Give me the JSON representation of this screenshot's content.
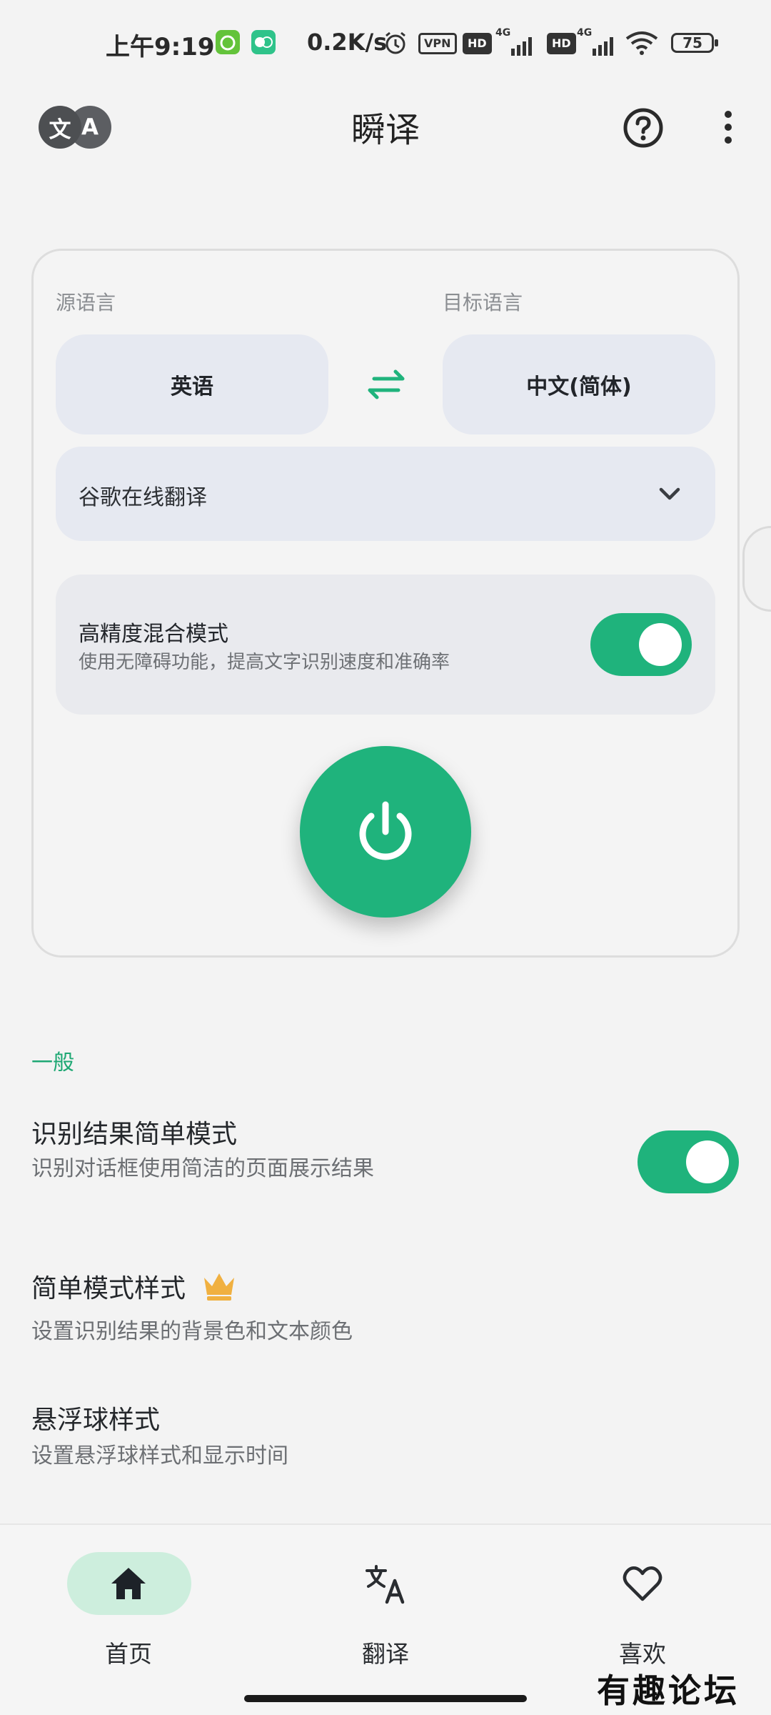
{
  "status_bar": {
    "time": "上午9:19",
    "network_speed": "0.2K/s",
    "vpn_label": "VPN",
    "hd1_label": "HD",
    "hd2_label": "HD",
    "net1_label": "4G",
    "net2_label": "4G",
    "battery_level": "75",
    "icons": [
      "app-badge-green-icon",
      "app-badge-translate-icon",
      "alarm-icon",
      "signal-icon",
      "wifi-icon",
      "battery-icon"
    ]
  },
  "app_bar": {
    "title": "瞬译",
    "logo_left": "文",
    "logo_right": "A",
    "icons": [
      "help-icon",
      "more-vert-icon"
    ]
  },
  "translate_card": {
    "source_label": "源语言",
    "target_label": "目标语言",
    "source_language": "英语",
    "target_language": "中文(简体)",
    "engine": "谷歌在线翻译",
    "high_precision": {
      "title": "高精度混合模式",
      "description": "使用无障碍功能，提高文字识别速度和准确率",
      "enabled": true
    }
  },
  "settings": {
    "section_title": "一般",
    "items": [
      {
        "title": "识别结果简单模式",
        "description": "识别对话框使用简洁的页面展示结果",
        "enabled": true
      },
      {
        "title": "简单模式样式",
        "description": "设置识别结果的背景色和文本颜色"
      },
      {
        "title": "悬浮球样式",
        "description": "设置悬浮球样式和显示时间"
      }
    ]
  },
  "bottom_nav": {
    "items": [
      {
        "label": "首页",
        "icon": "home-icon",
        "active": true
      },
      {
        "label": "翻译",
        "icon": "translate-icon",
        "active": false
      },
      {
        "label": "喜欢",
        "icon": "heart-icon",
        "active": false
      }
    ]
  },
  "watermark": "有趣论坛",
  "colors": {
    "accent": "#1fb37c",
    "chip_background": "#e6e9f1",
    "crown": "#f0b040"
  }
}
